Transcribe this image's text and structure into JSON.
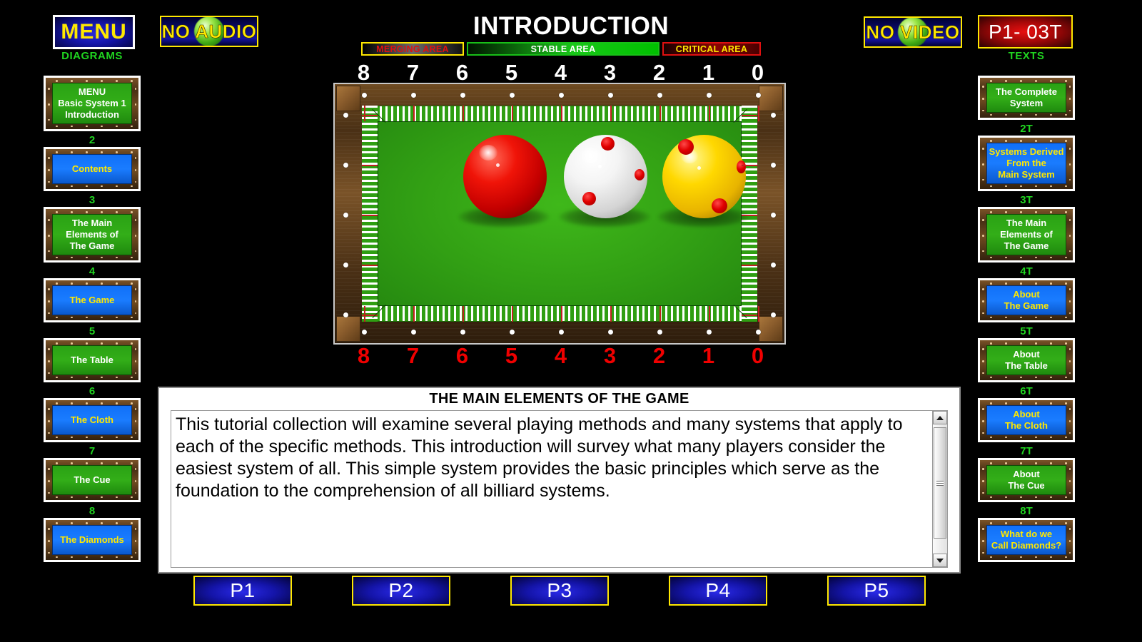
{
  "header": {
    "menu_label": "MENU",
    "no_audio_label": "NO AUDIO",
    "no_video_label": "NO VIDEO",
    "page_code": "P1- 03T",
    "title": "INTRODUCTION"
  },
  "area_bars": [
    {
      "label": "MERGING AREA",
      "text_color": "#e01010",
      "border_color": "#ffe800"
    },
    {
      "label": "STABLE AREA",
      "text_color": "#ffffff",
      "border_color": "#18c018"
    },
    {
      "label": "CRITICAL AREA",
      "text_color": "#ffe800",
      "border_color": "#e01010"
    }
  ],
  "table": {
    "numbers_top": [
      "8",
      "7",
      "6",
      "5",
      "4",
      "3",
      "2",
      "1",
      "0"
    ],
    "numbers_bottom": [
      "8",
      "7",
      "6",
      "5",
      "4",
      "3",
      "2",
      "1",
      "0"
    ],
    "balls": [
      {
        "name": "red-ball",
        "color": "#e40000"
      },
      {
        "name": "white-ball",
        "color": "#f2f2f2"
      },
      {
        "name": "yellow-ball",
        "color": "#ffd800"
      }
    ]
  },
  "diagrams": {
    "header": "DIAGRAMS",
    "items": [
      {
        "index": "",
        "label": "MENU\nBasic System 1\nIntroduction",
        "felt": "green"
      },
      {
        "index": "2",
        "label": "Contents",
        "felt": "blue"
      },
      {
        "index": "3",
        "label": "The Main\nElements of\nThe Game",
        "felt": "green"
      },
      {
        "index": "4",
        "label": "The Game",
        "felt": "blue"
      },
      {
        "index": "5",
        "label": "The Table",
        "felt": "green"
      },
      {
        "index": "6",
        "label": "The Cloth",
        "felt": "blue"
      },
      {
        "index": "7",
        "label": "The Cue",
        "felt": "green"
      },
      {
        "index": "8",
        "label": "The Diamonds",
        "felt": "blue"
      }
    ]
  },
  "texts": {
    "header": "TEXTS",
    "items": [
      {
        "index": "",
        "label": "The Complete\nSystem",
        "felt": "green"
      },
      {
        "index": "2T",
        "label": "Systems Derived\nFrom the\nMain System",
        "felt": "blue"
      },
      {
        "index": "3T",
        "label": "The Main\nElements of\nThe Game",
        "felt": "green"
      },
      {
        "index": "4T",
        "label": "About\nThe Game",
        "felt": "blue"
      },
      {
        "index": "5T",
        "label": "About\nThe Table",
        "felt": "green"
      },
      {
        "index": "6T",
        "label": "About\nThe Cloth",
        "felt": "blue"
      },
      {
        "index": "7T",
        "label": "About\nThe Cue",
        "felt": "green"
      },
      {
        "index": "8T",
        "label": "What do we\nCall Diamonds?",
        "felt": "blue"
      }
    ]
  },
  "text_panel": {
    "title": "THE MAIN ELEMENTS OF THE GAME",
    "body": "This tutorial collection will examine several playing methods and many systems that apply to each of the specific methods. This introduction will survey what many players consider the easiest system of all. This simple system provides the basic principles which serve as the foundation to the comprehension of all billiard systems.",
    "scroll_up_icon": "scroll-up-arrow",
    "scroll_down_icon": "scroll-down-arrow"
  },
  "page_buttons": [
    {
      "label": "P1"
    },
    {
      "label": "P2"
    },
    {
      "label": "P3"
    },
    {
      "label": "P4"
    },
    {
      "label": "P5"
    }
  ]
}
